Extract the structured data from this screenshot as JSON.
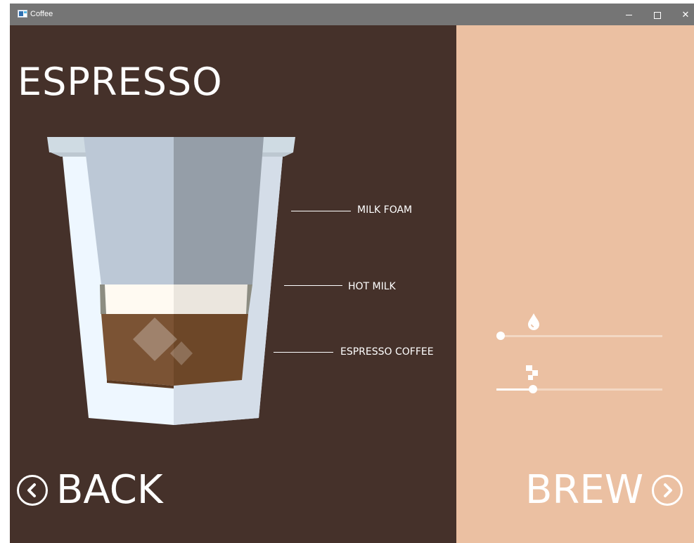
{
  "window": {
    "title": "Coffee",
    "controls": [
      "minimize-icon",
      "maximize-icon",
      "close-icon"
    ]
  },
  "main": {
    "title": "ESPRESSO",
    "layers": [
      {
        "label": "MILK FOAM",
        "color": "#bcc8d6"
      },
      {
        "label": "HOT MILK",
        "color": "#fffaf2"
      },
      {
        "label": "ESPRESSO COFFEE",
        "color": "#7b5334"
      }
    ],
    "back_label": "BACK",
    "brew_label": "BREW"
  },
  "controls": {
    "water": {
      "icon": "water-drop-icon",
      "value": 0.0
    },
    "sugar": {
      "icon": "sugar-cubes-icon",
      "value": 0.22
    }
  },
  "colors": {
    "left_bg": "#45312a",
    "right_bg": "#ebc0a2",
    "titlebar": "#757575",
    "text": "#ffffff"
  }
}
